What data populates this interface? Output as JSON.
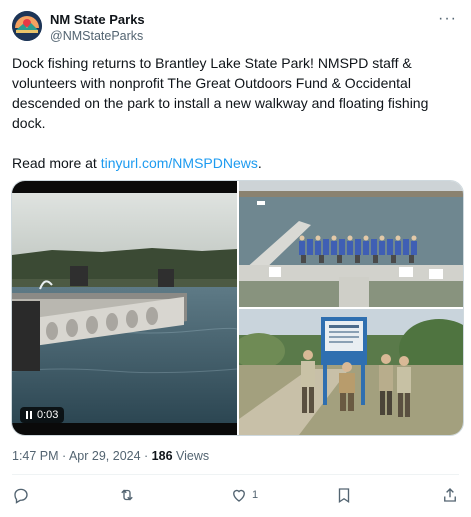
{
  "account": {
    "name": "NM State Parks",
    "handle": "@NMStateParks"
  },
  "post": {
    "text": "Dock fishing returns to Brantley Lake State Park! NMSPD staff & volunteers with nonprofit The Great Outdoors Fund & Occidental descended on the park to install a new walkway and floating fishing dock.",
    "read_more_prefix": "Read more at ",
    "link_text": "tinyurl.com/NMSPDNews",
    "link_suffix": "."
  },
  "media": {
    "video_time": "0:03"
  },
  "meta": {
    "timestamp": "1:47 PM · Apr 29, 2024 · ",
    "views_count": "186",
    "views_label": " Views"
  },
  "actions": {
    "like_count": "1"
  },
  "icons": [
    "more-icon",
    "reply-icon",
    "repost-icon",
    "like-icon",
    "bookmark-icon",
    "share-icon",
    "pause-icon"
  ],
  "colors": {
    "link": "#1d9bf0",
    "secondary_text": "#536471"
  }
}
